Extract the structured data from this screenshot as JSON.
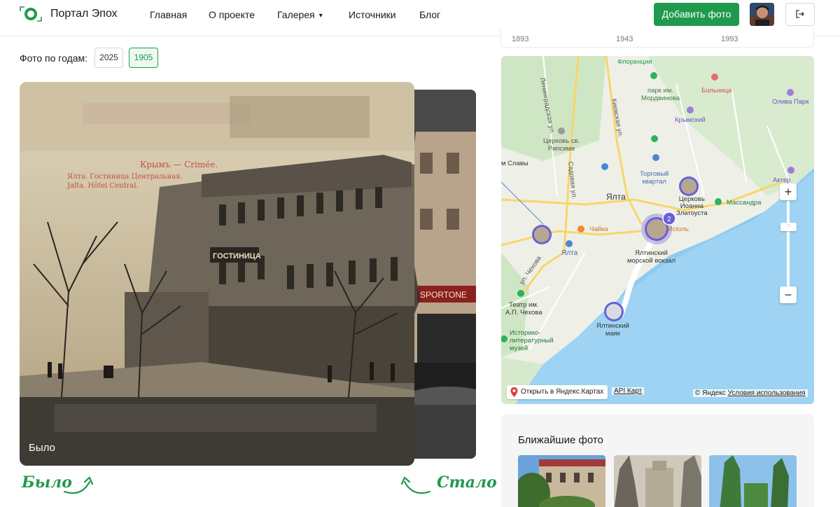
{
  "header": {
    "brand": "Портал Эпох",
    "nav": [
      "Главная",
      "О проекте",
      "Галерея",
      "Источники",
      "Блог"
    ],
    "add_photo": "Добавить фото",
    "accent": "#1f9a4c"
  },
  "filter": {
    "label": "Фото по годам:",
    "years": [
      "2025",
      "1905"
    ],
    "active_year": "1905"
  },
  "photo": {
    "caption": "Было",
    "postcard_header": "Крымъ — Crimée.",
    "postcard_sub1": "Ялта.  Гостиница Центральная.",
    "postcard_sub2": "Jalta.  Hôtel Central.",
    "sign": "ГОСТИНИЦА"
  },
  "compare_labels": {
    "before": "Было",
    "after": "Стало"
  },
  "timeline": {
    "ticks": [
      "1893",
      "1943",
      "1993"
    ]
  },
  "map": {
    "labels": {
      "florentina": "Флоренция",
      "park": "парк им.\nМордвинова",
      "hospital": "Больница",
      "oliva": "Олива Парк",
      "krymsky": "Крымский",
      "church_ripsime": "Церковь св.\nРипсиме",
      "trade": "Торговый\nквартал",
      "slavy": "м Славы",
      "yalta_city": "Ялта",
      "church_ioann": "Церковь\nИоанна\nЗлатоуста",
      "massandra": "Массандра",
      "akter": "Актер",
      "chaika": "Чайка",
      "istol": "Исtoль",
      "vokzal": "Ялтинский\nморской вокзал",
      "yalta_station": "Ялта",
      "theatre": "Театр им.\nА.П. Чехова",
      "museum": "Историко-\nлитературный\nмузей",
      "mayak": "Ялтинский\nмаяк",
      "street1": "Ленинградская ул.",
      "street2": "Киевская ул.",
      "street3": "Садовая ул.",
      "street4": "ул. Чехова",
      "cluster": "2"
    },
    "open_yandex": "Открыть в Яндекс.Картах",
    "api": "API Карт",
    "copyright": "© Яндекс",
    "terms": "Условия использования",
    "zoom_in": "+",
    "zoom_out": "−"
  },
  "nearby": {
    "title": "Ближайшие фото"
  }
}
